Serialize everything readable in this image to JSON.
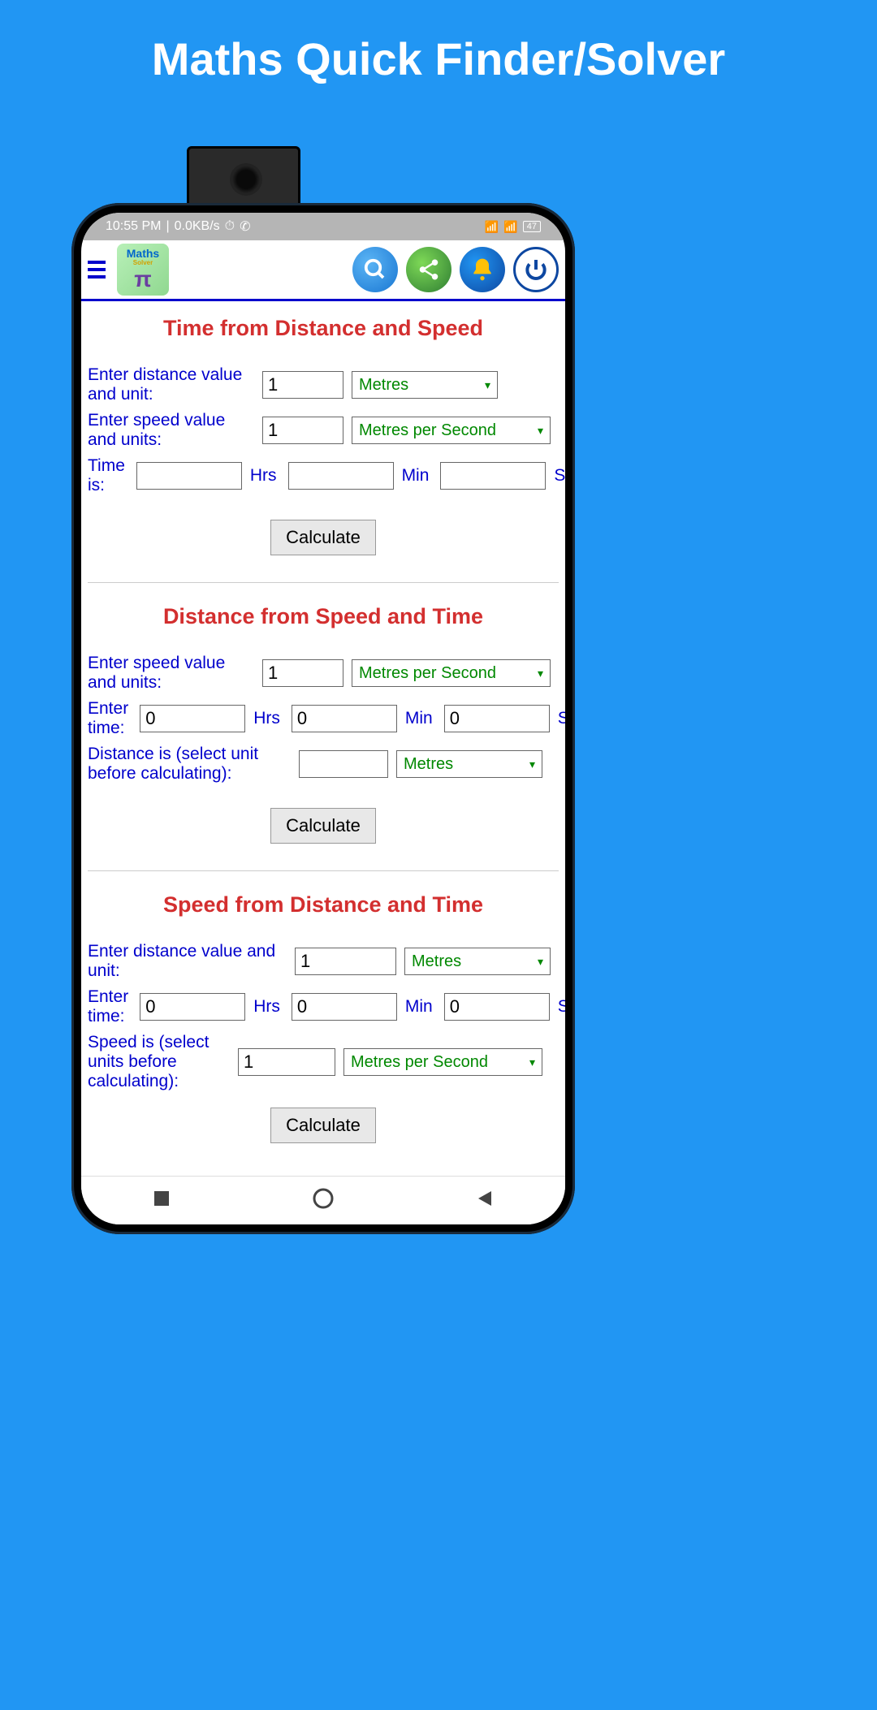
{
  "promo": {
    "title": "Maths Quick Finder/Solver"
  },
  "status": {
    "time": "10:55 PM",
    "data": "0.0KB/s",
    "battery": "47"
  },
  "header": {
    "logo_top": "Maths",
    "logo_mid": "Solver"
  },
  "section1": {
    "title": "Time from Distance and Speed",
    "dist_label": "Enter distance value and unit:",
    "dist_val": "1",
    "dist_unit": "Metres",
    "speed_label": "Enter speed value and units:",
    "speed_val": "1",
    "speed_unit": "Metres per Second",
    "time_label": "Time is:",
    "hrs_val": "",
    "hrs_lbl": "Hrs",
    "min_val": "",
    "min_lbl": "Min",
    "sec_val": "",
    "sec_lbl": "Se",
    "calc": "Calculate"
  },
  "section2": {
    "title": "Distance from Speed and Time",
    "speed_label": "Enter speed value and units:",
    "speed_val": "1",
    "speed_unit": "Metres per Second",
    "time_label": "Enter time:",
    "hrs_val": "0",
    "hrs_lbl": "Hrs",
    "min_val": "0",
    "min_lbl": "Min",
    "sec_val": "0",
    "sec_lbl": "Se",
    "dist_label": "Distance is (select unit before calculating):",
    "dist_val": "",
    "dist_unit": "Metres",
    "calc": "Calculate"
  },
  "section3": {
    "title": "Speed from Distance and Time",
    "dist_label": "Enter distance value and unit:",
    "dist_val": "1",
    "dist_unit": "Metres",
    "time_label": "Enter time:",
    "hrs_val": "0",
    "hrs_lbl": "Hrs",
    "min_val": "0",
    "min_lbl": "Min",
    "sec_val": "0",
    "sec_lbl": "Se",
    "speed_label": "Speed is (select units before calculating):",
    "speed_val": "1",
    "speed_unit": "Metres per Second",
    "calc": "Calculate"
  }
}
